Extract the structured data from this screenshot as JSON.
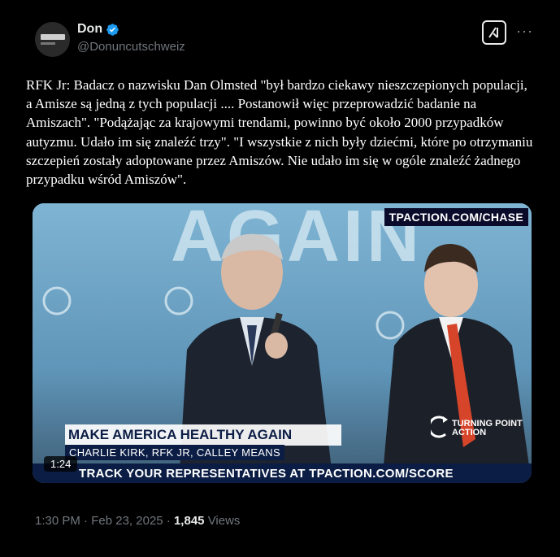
{
  "author": {
    "name": "Don",
    "handle": "@Donuncutschweiz",
    "verified": true,
    "verified_color": "#1d9bf0"
  },
  "tweet_text": "RFK Jr: Badacz o nazwisku Dan Olmsted \"był bardzo ciekawy nieszczepionych populacji, a Amisze są jedną z tych populacji .... Postanowił więc przeprowadzić badanie na Amiszach\". \"Podążając za krajowymi trendami, powinno być około 2000 przypadków autyzmu. Udało im się znaleźć trzy\". \"I wszystkie z nich były dziećmi, które po otrzymaniu szczepień zostały adoptowane przez Amiszów. Nie udało im się w ogóle znaleźć żadnego przypadku wśród Amiszów\".",
  "video": {
    "url_badge": "TPACTION.COM/CHASE",
    "lower_third_title": "MAKE AMERICA HEALTHY AGAIN",
    "lower_third_names": "CHARLIE KIRK, RFK JR, CALLEY MEANS",
    "ticker": "TRACK YOUR REPRESENTATIVES AT TPACTION.COM/SCORE",
    "corner_logo": "TURNING POINT ACTION",
    "duration": "1:24"
  },
  "meta": {
    "time": "1:30 PM",
    "date": "Feb 23, 2025",
    "views_count": "1,845",
    "views_label": "Views"
  },
  "icons": [
    "verified-badge-icon",
    "grok-icon",
    "more-icon",
    "turning-point-logo-icon"
  ]
}
